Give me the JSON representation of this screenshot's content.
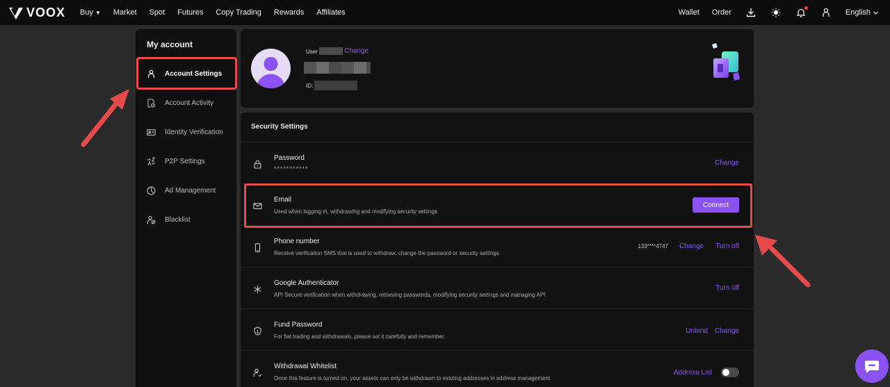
{
  "brand": {
    "name": "VOOX"
  },
  "nav": {
    "links": [
      "Buy",
      "Market",
      "Spot",
      "Futures",
      "Copy Trading",
      "Rewards",
      "Affiliates"
    ],
    "wallet": "Wallet",
    "order": "Order",
    "language": "English"
  },
  "sidebar": {
    "title": "My account",
    "items": [
      {
        "label": "Account Settings",
        "icon": "user-icon",
        "active": true
      },
      {
        "label": "Account Activity",
        "icon": "activity-doc-icon"
      },
      {
        "label": "Identity Verification",
        "icon": "id-card-icon"
      },
      {
        "label": "P2P Settings",
        "icon": "p2p-icon"
      },
      {
        "label": "Ad Management",
        "icon": "pie-chart-icon"
      },
      {
        "label": "Blacklist",
        "icon": "user-block-icon"
      }
    ]
  },
  "profile": {
    "user_label": "User",
    "change": "Change",
    "id_label": "ID:"
  },
  "security": {
    "title": "Security Settings",
    "rows": [
      {
        "title": "Password",
        "desc": "***********",
        "icon": "lock-icon",
        "actions": [
          "Change"
        ]
      },
      {
        "title": "Email",
        "desc": "Used when logging in, withdrawing and modifying security settings",
        "icon": "mail-icon",
        "button": "Connect"
      },
      {
        "title": "Phone number",
        "desc": "Receive verification SMS that is used to withdraw, change the password or security settings",
        "icon": "phone-icon",
        "value": "133****4747",
        "actions": [
          "Change",
          "Turn off"
        ]
      },
      {
        "title": "Google Authenticator",
        "desc": "API Secure verification when withdrawing, retrieving passwords, modifying security settings and managing API",
        "icon": "authenticator-icon",
        "actions": [
          "Turn off"
        ]
      },
      {
        "title": "Fund Password",
        "desc": "For fiat trading and withdrawals, please set it carefully and remember.",
        "icon": "shield-icon",
        "actions": [
          "Unbind",
          "Change"
        ]
      },
      {
        "title": "Withdrawal Whitelist",
        "desc": "Once this feature is turned on, your assets can only be withdrawn to existing addresses in address management",
        "icon": "user-check-icon",
        "actions": [
          "Address List"
        ],
        "toggle_on": false
      }
    ]
  },
  "colors": {
    "accent": "#8a52f0",
    "highlight": "#e74a4a",
    "background": "#2b2b2b",
    "card": "#121212"
  }
}
